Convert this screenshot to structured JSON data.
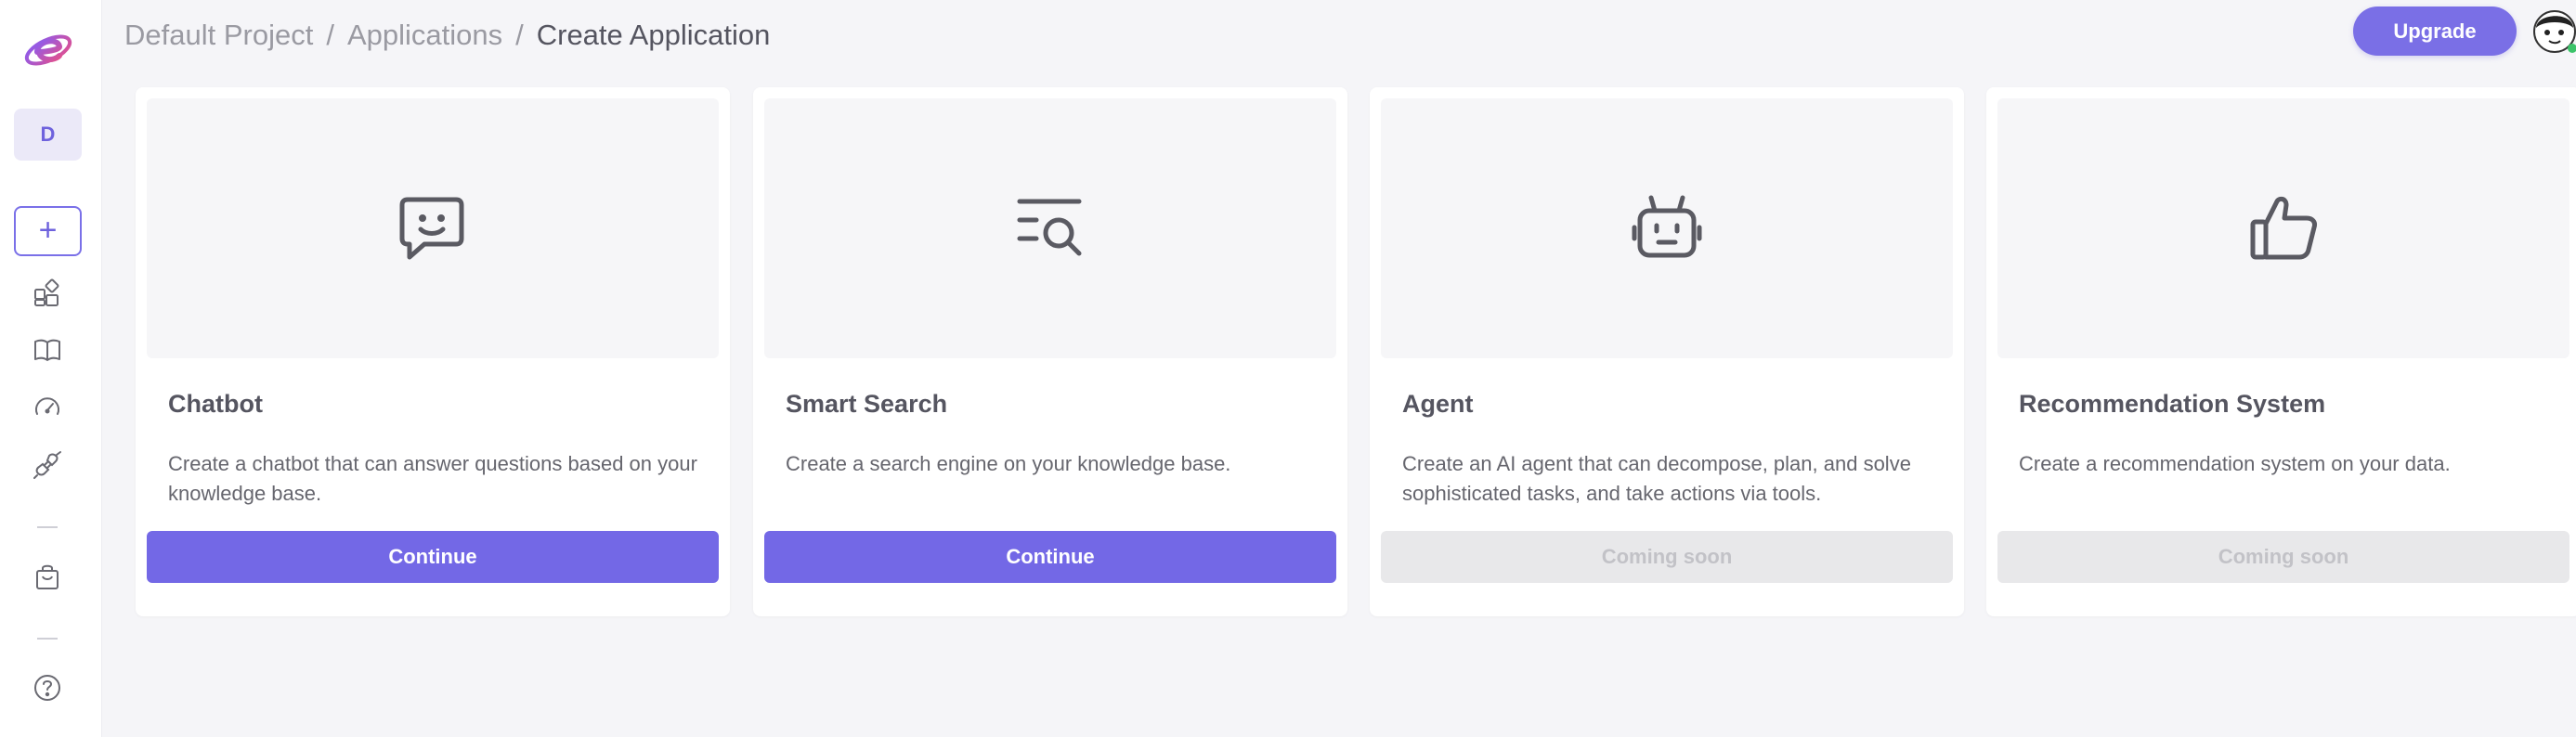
{
  "sidebar": {
    "project_initial": "D",
    "add_label": "+",
    "icons": [
      "apps-icon",
      "book-icon",
      "gauge-icon",
      "plug-icon",
      "bag-icon",
      "help-icon"
    ]
  },
  "breadcrumb": {
    "items": [
      "Default Project",
      "Applications"
    ],
    "separator": "/",
    "current": "Create Application"
  },
  "header": {
    "upgrade_label": "Upgrade"
  },
  "cards": [
    {
      "title": "Chatbot",
      "description": "Create a chatbot that can answer questions based on your knowledge base.",
      "button": "Continue",
      "icon": "chat-icon",
      "enabled": true
    },
    {
      "title": "Smart Search",
      "description": "Create a search engine on your knowledge base.",
      "button": "Continue",
      "icon": "search-list-icon",
      "enabled": true
    },
    {
      "title": "Agent",
      "description": "Create an AI agent that can decompose, plan, and solve sophisticated tasks, and take actions via tools.",
      "button": "Coming soon",
      "icon": "robot-icon",
      "enabled": false
    },
    {
      "title": "Recommendation System",
      "description": "Create a recommendation system on your data.",
      "button": "Coming soon",
      "icon": "thumbs-up-icon",
      "enabled": false
    }
  ],
  "colors": {
    "accent": "#7368e6",
    "disabled_bg": "#e8e8ea",
    "disabled_text": "#c2c2c7",
    "background": "#f5f5f8"
  }
}
